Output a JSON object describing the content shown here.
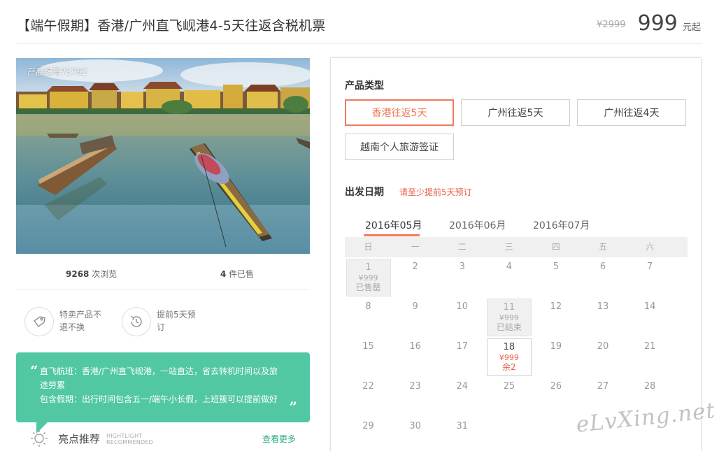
{
  "header": {
    "title": "【端午假期】香港/广州直飞岘港4-5天往返含税机票",
    "price_old": "¥2999",
    "price": "999",
    "price_unit": "元起"
  },
  "photo": {
    "product_no": "产品编号73762"
  },
  "stats": {
    "views_num": "9268",
    "views_label": " 次浏览",
    "sold_num": "4",
    "sold_label": " 件已售"
  },
  "features": [
    {
      "icon": "tag-icon",
      "text": "特卖产品不退不换"
    },
    {
      "icon": "clock-history-icon",
      "text": "提前5天预订"
    }
  ],
  "quote": {
    "line1": "直飞航班：香港/广州直飞岘港，一站直达，省去转机时间以及旅途劳累",
    "line2": "包含假期：出行时间包含五一/端午小长假，上班簇可以提前做好"
  },
  "highlight": {
    "icon": "sun-icon",
    "title": "亮点推荐",
    "en_line1": "HIGHTLIGHT",
    "en_line2": "RECOMMENDED",
    "more": "查看更多"
  },
  "product_type": {
    "title": "产品类型",
    "options": [
      "香港往返5天",
      "广州往返5天",
      "广州往返4天",
      "越南个人旅游签证"
    ],
    "selected": 0
  },
  "departure": {
    "title": "出发日期",
    "hint": "请至少提前5天预订",
    "months": [
      "2016年05月",
      "2016年06月",
      "2016年07月"
    ],
    "active_month": 0,
    "weekdays": [
      "日",
      "一",
      "二",
      "三",
      "四",
      "五",
      "六"
    ],
    "days": [
      {
        "d": "1",
        "price": "¥999",
        "status": "已售罄",
        "state": "soldout"
      },
      {
        "d": "2"
      },
      {
        "d": "3"
      },
      {
        "d": "4"
      },
      {
        "d": "5"
      },
      {
        "d": "6"
      },
      {
        "d": "7"
      },
      {
        "d": "8"
      },
      {
        "d": "9"
      },
      {
        "d": "10"
      },
      {
        "d": "11",
        "price": "¥999",
        "status": "已结束",
        "state": "soldout"
      },
      {
        "d": "12"
      },
      {
        "d": "13"
      },
      {
        "d": "14"
      },
      {
        "d": "15"
      },
      {
        "d": "16"
      },
      {
        "d": "17"
      },
      {
        "d": "18",
        "price": "¥999",
        "status": "余2",
        "state": "avail"
      },
      {
        "d": "19"
      },
      {
        "d": "20"
      },
      {
        "d": "21"
      },
      {
        "d": "22"
      },
      {
        "d": "23"
      },
      {
        "d": "24"
      },
      {
        "d": "25"
      },
      {
        "d": "26"
      },
      {
        "d": "27"
      },
      {
        "d": "28"
      },
      {
        "d": "29"
      },
      {
        "d": "30"
      },
      {
        "d": "31"
      }
    ]
  },
  "watermark": "eLvXing.net",
  "colors": {
    "accent": "#f07a5e",
    "hint_red": "#e7604a",
    "teal": "#52c7a4",
    "link_green": "#2aa87f"
  }
}
